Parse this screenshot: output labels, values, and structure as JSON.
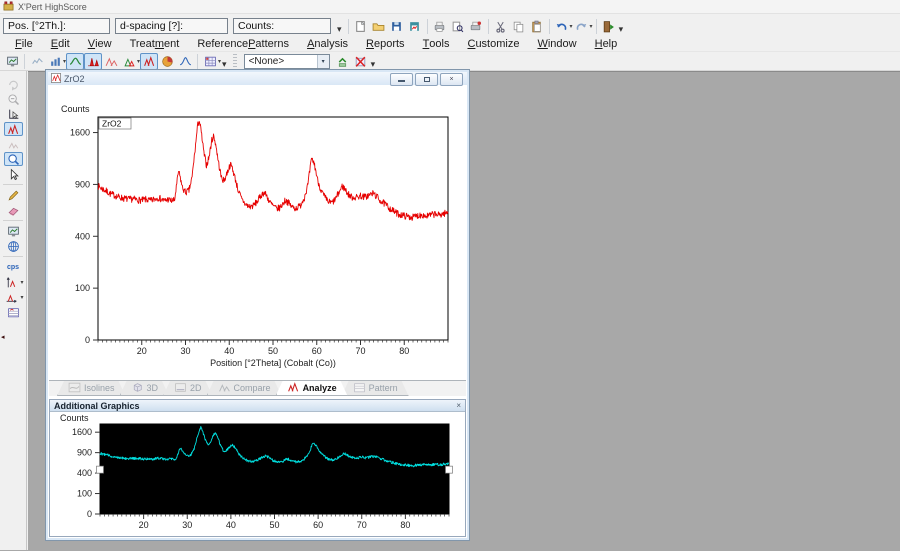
{
  "window": {
    "title": "X'Pert HighScore"
  },
  "toolbar_fields": [
    {
      "label": "Pos. [°2Th.]:",
      "value": ""
    },
    {
      "label": "d-spacing [?]:",
      "value": ""
    },
    {
      "label": "Counts:",
      "value": ""
    }
  ],
  "toolbar_main": {
    "icons": [
      {
        "n": "new-document"
      },
      {
        "n": "open-file"
      },
      {
        "n": "save-file"
      },
      {
        "n": "save-analysis"
      },
      {
        "sep": true
      },
      {
        "n": "print"
      },
      {
        "n": "print-preview"
      },
      {
        "n": "print-settings"
      },
      {
        "sep": true
      },
      {
        "n": "cut"
      },
      {
        "n": "copy"
      },
      {
        "n": "paste"
      },
      {
        "sep": true
      },
      {
        "n": "undo",
        "dd": true
      },
      {
        "n": "redo",
        "dd": true
      },
      {
        "sep": true
      },
      {
        "n": "exit"
      },
      {
        "ovf": true
      }
    ]
  },
  "menu": {
    "items": [
      {
        "label": "File",
        "accel": 0
      },
      {
        "label": "Edit",
        "accel": 0
      },
      {
        "label": "View",
        "accel": 0
      },
      {
        "label": "Treatment",
        "accel": 5
      },
      {
        "label": "Reference Patterns",
        "accel": 10
      },
      {
        "label": "Analysis",
        "accel": 0
      },
      {
        "label": "Reports",
        "accel": 0
      },
      {
        "label": "Tools",
        "accel": 0
      },
      {
        "label": "Customize",
        "accel": 0
      },
      {
        "label": "Window",
        "accel": 0
      },
      {
        "label": "Help",
        "accel": 0
      }
    ]
  },
  "toolbar_view": {
    "combo_value": "<None>",
    "items": [
      {
        "n": "display-mode"
      },
      {
        "sep": true
      },
      {
        "n": "line-graph"
      },
      {
        "n": "bar-graph",
        "dd": true
      },
      {
        "n": "smooth-line",
        "pressed": true
      },
      {
        "n": "peaks-filled",
        "pressed": true
      },
      {
        "n": "peaks-outline"
      },
      {
        "n": "delta-peaks",
        "dd": true
      },
      {
        "n": "peak-analyze",
        "pressed": true
      },
      {
        "n": "pie-chart"
      },
      {
        "n": "profile-fit"
      },
      {
        "sep": true
      },
      {
        "n": "pattern-grid",
        "dd": true
      },
      {
        "ovf": true
      },
      {
        "grip": true
      },
      {
        "combo": true
      },
      {
        "n": "accept-pattern"
      },
      {
        "n": "delete-pattern"
      },
      {
        "ovf": true
      }
    ]
  },
  "sidebar": {
    "items": [
      {
        "n": "pan-rotate",
        "disabled": true
      },
      {
        "n": "zoom-out",
        "disabled": true
      },
      {
        "n": "axis-pointer"
      },
      {
        "n": "peak-mode",
        "pressed": true
      },
      {
        "n": "peaks-small",
        "disabled": true
      },
      {
        "n": "zoom-in",
        "pressed": true
      },
      {
        "n": "pointer"
      },
      {
        "sep": true
      },
      {
        "n": "pencil"
      },
      {
        "n": "eraser"
      },
      {
        "sep": true
      },
      {
        "n": "display-graphics"
      },
      {
        "n": "globe-target"
      },
      {
        "sep": true
      },
      {
        "n": "cps-units"
      },
      {
        "n": "y-axis-scale",
        "dd": true
      },
      {
        "n": "x-axis-scale",
        "dd": true
      },
      {
        "n": "pattern-table"
      }
    ]
  },
  "document": {
    "title": "ZrO2",
    "controls": {
      "minimize": "minimize",
      "restore": "restore",
      "close": "close"
    }
  },
  "tabs": [
    {
      "label": "Isolines",
      "active": false
    },
    {
      "label": "3D",
      "active": false
    },
    {
      "label": "2D",
      "active": false
    },
    {
      "label": "Compare",
      "active": false
    },
    {
      "label": "Analyze",
      "active": true
    },
    {
      "label": "Pattern",
      "active": false
    }
  ],
  "additional_panel": {
    "title": "Additional Graphics",
    "close": "×"
  },
  "chart_data": [
    {
      "type": "line",
      "id": "main",
      "title_inside": "ZrO2",
      "ylabel": "Counts",
      "xlabel": "Position [°2Theta] (Cobalt (Co))",
      "x_range": [
        10,
        90
      ],
      "y_scale": "sqrt",
      "sqrt_top": 43,
      "x_ticks": [
        20,
        30,
        40,
        50,
        60,
        70,
        80
      ],
      "y_ticks": [
        0,
        100,
        400,
        900,
        1600
      ],
      "line_color": "#e60000",
      "bg": "#ffffff",
      "border": "#000000",
      "grid": false,
      "noise_seed": 7,
      "noise_amp": 1.3,
      "points": [
        [
          10,
          880
        ],
        [
          11,
          850
        ],
        [
          12,
          820
        ],
        [
          13,
          790
        ],
        [
          14,
          775
        ],
        [
          15,
          755
        ],
        [
          16,
          745
        ],
        [
          17,
          735
        ],
        [
          18,
          740
        ],
        [
          19,
          730
        ],
        [
          20,
          725
        ],
        [
          21,
          735
        ],
        [
          22,
          720
        ],
        [
          23,
          740
        ],
        [
          23.8,
          755
        ],
        [
          24.5,
          735
        ],
        [
          25.2,
          720
        ],
        [
          26,
          735
        ],
        [
          26.8,
          720
        ],
        [
          27.5,
          725
        ],
        [
          28,
          900
        ],
        [
          28.4,
          1060
        ],
        [
          28.8,
          980
        ],
        [
          29.3,
          860
        ],
        [
          30,
          810
        ],
        [
          30.8,
          830
        ],
        [
          31.5,
          980
        ],
        [
          32.2,
          1350
        ],
        [
          32.8,
          1720
        ],
        [
          33.1,
          1800
        ],
        [
          33.5,
          1650
        ],
        [
          34.2,
          1300
        ],
        [
          34.8,
          1130
        ],
        [
          35.4,
          1250
        ],
        [
          36,
          1480
        ],
        [
          36.4,
          1550
        ],
        [
          36.9,
          1430
        ],
        [
          37.5,
          1180
        ],
        [
          38.2,
          980
        ],
        [
          38.8,
          940
        ],
        [
          39.5,
          1040
        ],
        [
          40.2,
          1140
        ],
        [
          40.6,
          1120
        ],
        [
          41.2,
          1000
        ],
        [
          42,
          840
        ],
        [
          42.8,
          740
        ],
        [
          43.6,
          690
        ],
        [
          44.5,
          660
        ],
        [
          45.5,
          670
        ],
        [
          46.5,
          720
        ],
        [
          47.3,
          780
        ],
        [
          47.9,
          810
        ],
        [
          48.5,
          780
        ],
        [
          49.2,
          710
        ],
        [
          50,
          670
        ],
        [
          50.8,
          640
        ],
        [
          51.6,
          650
        ],
        [
          52.4,
          700
        ],
        [
          52.9,
          730
        ],
        [
          53.5,
          700
        ],
        [
          54.3,
          660
        ],
        [
          55.2,
          645
        ],
        [
          56.2,
          670
        ],
        [
          57.2,
          760
        ],
        [
          58,
          900
        ],
        [
          58.7,
          1180
        ],
        [
          59,
          1210
        ],
        [
          59.5,
          1140
        ],
        [
          60.2,
          950
        ],
        [
          61,
          830
        ],
        [
          61.8,
          760
        ],
        [
          62.6,
          710
        ],
        [
          63.5,
          700
        ],
        [
          64.3,
          740
        ],
        [
          65.2,
          820
        ],
        [
          65.8,
          880
        ],
        [
          66.4,
          850
        ],
        [
          67.2,
          790
        ],
        [
          68,
          760
        ],
        [
          69,
          755
        ],
        [
          70,
          775
        ],
        [
          70.8,
          760
        ],
        [
          71.6,
          770
        ],
        [
          72.4,
          790
        ],
        [
          73,
          800
        ],
        [
          73.8,
          760
        ],
        [
          74.6,
          720
        ],
        [
          75.5,
          690
        ],
        [
          76.4,
          655
        ],
        [
          77.3,
          625
        ],
        [
          78.2,
          600
        ],
        [
          79,
          585
        ],
        [
          80,
          575
        ],
        [
          81,
          565
        ],
        [
          82,
          560
        ],
        [
          83,
          575
        ],
        [
          84,
          585
        ],
        [
          85,
          570
        ],
        [
          86,
          580
        ],
        [
          87,
          590
        ],
        [
          88,
          580
        ],
        [
          89,
          595
        ],
        [
          90,
          600
        ]
      ]
    },
    {
      "type": "line",
      "id": "overview",
      "ylabel": "Counts",
      "xlabel": "",
      "x_range": [
        10,
        90
      ],
      "y_scale": "sqrt",
      "sqrt_top": 44,
      "x_ticks": [
        20,
        30,
        40,
        50,
        60,
        70,
        80
      ],
      "y_ticks": [
        0,
        100,
        400,
        900,
        1600
      ],
      "line_color": "#00e0e0",
      "bg": "#000000",
      "border": "#000000",
      "grid": false,
      "noise_seed": 12,
      "noise_amp": 1.3,
      "points_ref": 0,
      "handles": {
        "value": 470
      }
    }
  ]
}
